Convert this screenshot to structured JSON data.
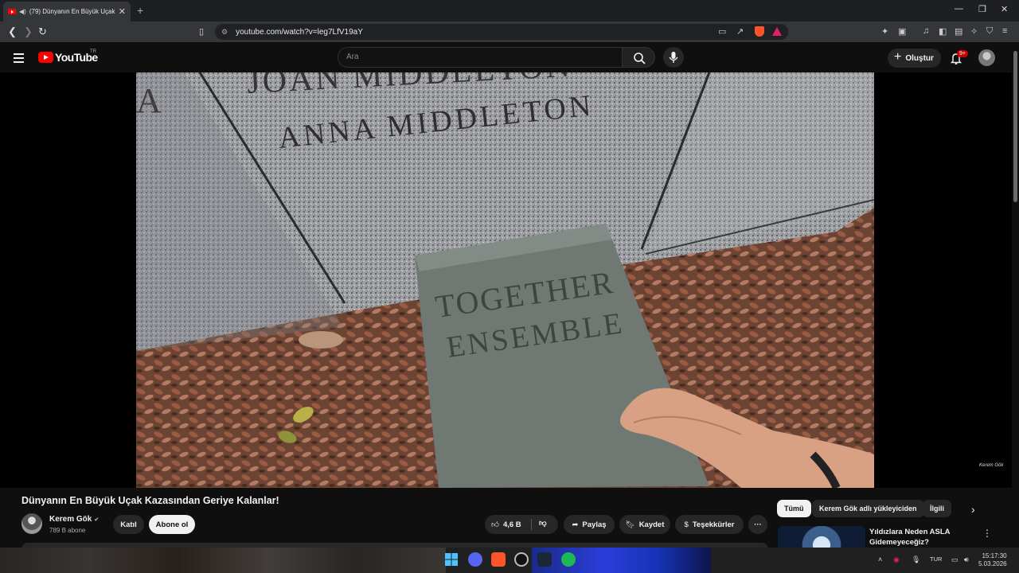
{
  "browser": {
    "tab_title": "(79) Dünyanın En Büyük Uçak",
    "url": "youtube.com/watch?v=leg7LfV19aY"
  },
  "youtube": {
    "logo_text": "YouTube",
    "country_code": "TR",
    "search_placeholder": "Ara",
    "create_label": "Oluştur",
    "notification_count": "9+"
  },
  "video": {
    "engraving_top": "JOAN MIDDLETON",
    "engraving_main": "ANNA MIDDLETON",
    "plaque_line1": "TOGETHER",
    "plaque_line2": "ENSEMBLE",
    "watermark": "Kerem Gök",
    "title": "Dünyanın En Büyük Uçak Kazasından Geriye Kalanlar!"
  },
  "channel": {
    "name": "Kerem Gök",
    "subscribers": "789 B abone",
    "join_label": "Katıl",
    "subscribe_label": "Abone ol"
  },
  "actions": {
    "likes": "4,6 B",
    "share_label": "Paylaş",
    "save_label": "Kaydet",
    "thanks_label": "Teşekkürler",
    "more_label": "···"
  },
  "sidebar": {
    "chips": [
      "Tümü",
      "Kerem Gök adlı yükleyiciden",
      "İlgili"
    ],
    "recommended_title": "Yıldızlara Neden ASLA Gidemeyeceğiz?"
  },
  "taskbar": {
    "language": "TUR",
    "time": "15:17:30",
    "date": "5.03.2026"
  },
  "colors": {
    "yt_red": "#ff0000",
    "background": "#0f0f0f",
    "brave_orange": "#fb542b"
  }
}
